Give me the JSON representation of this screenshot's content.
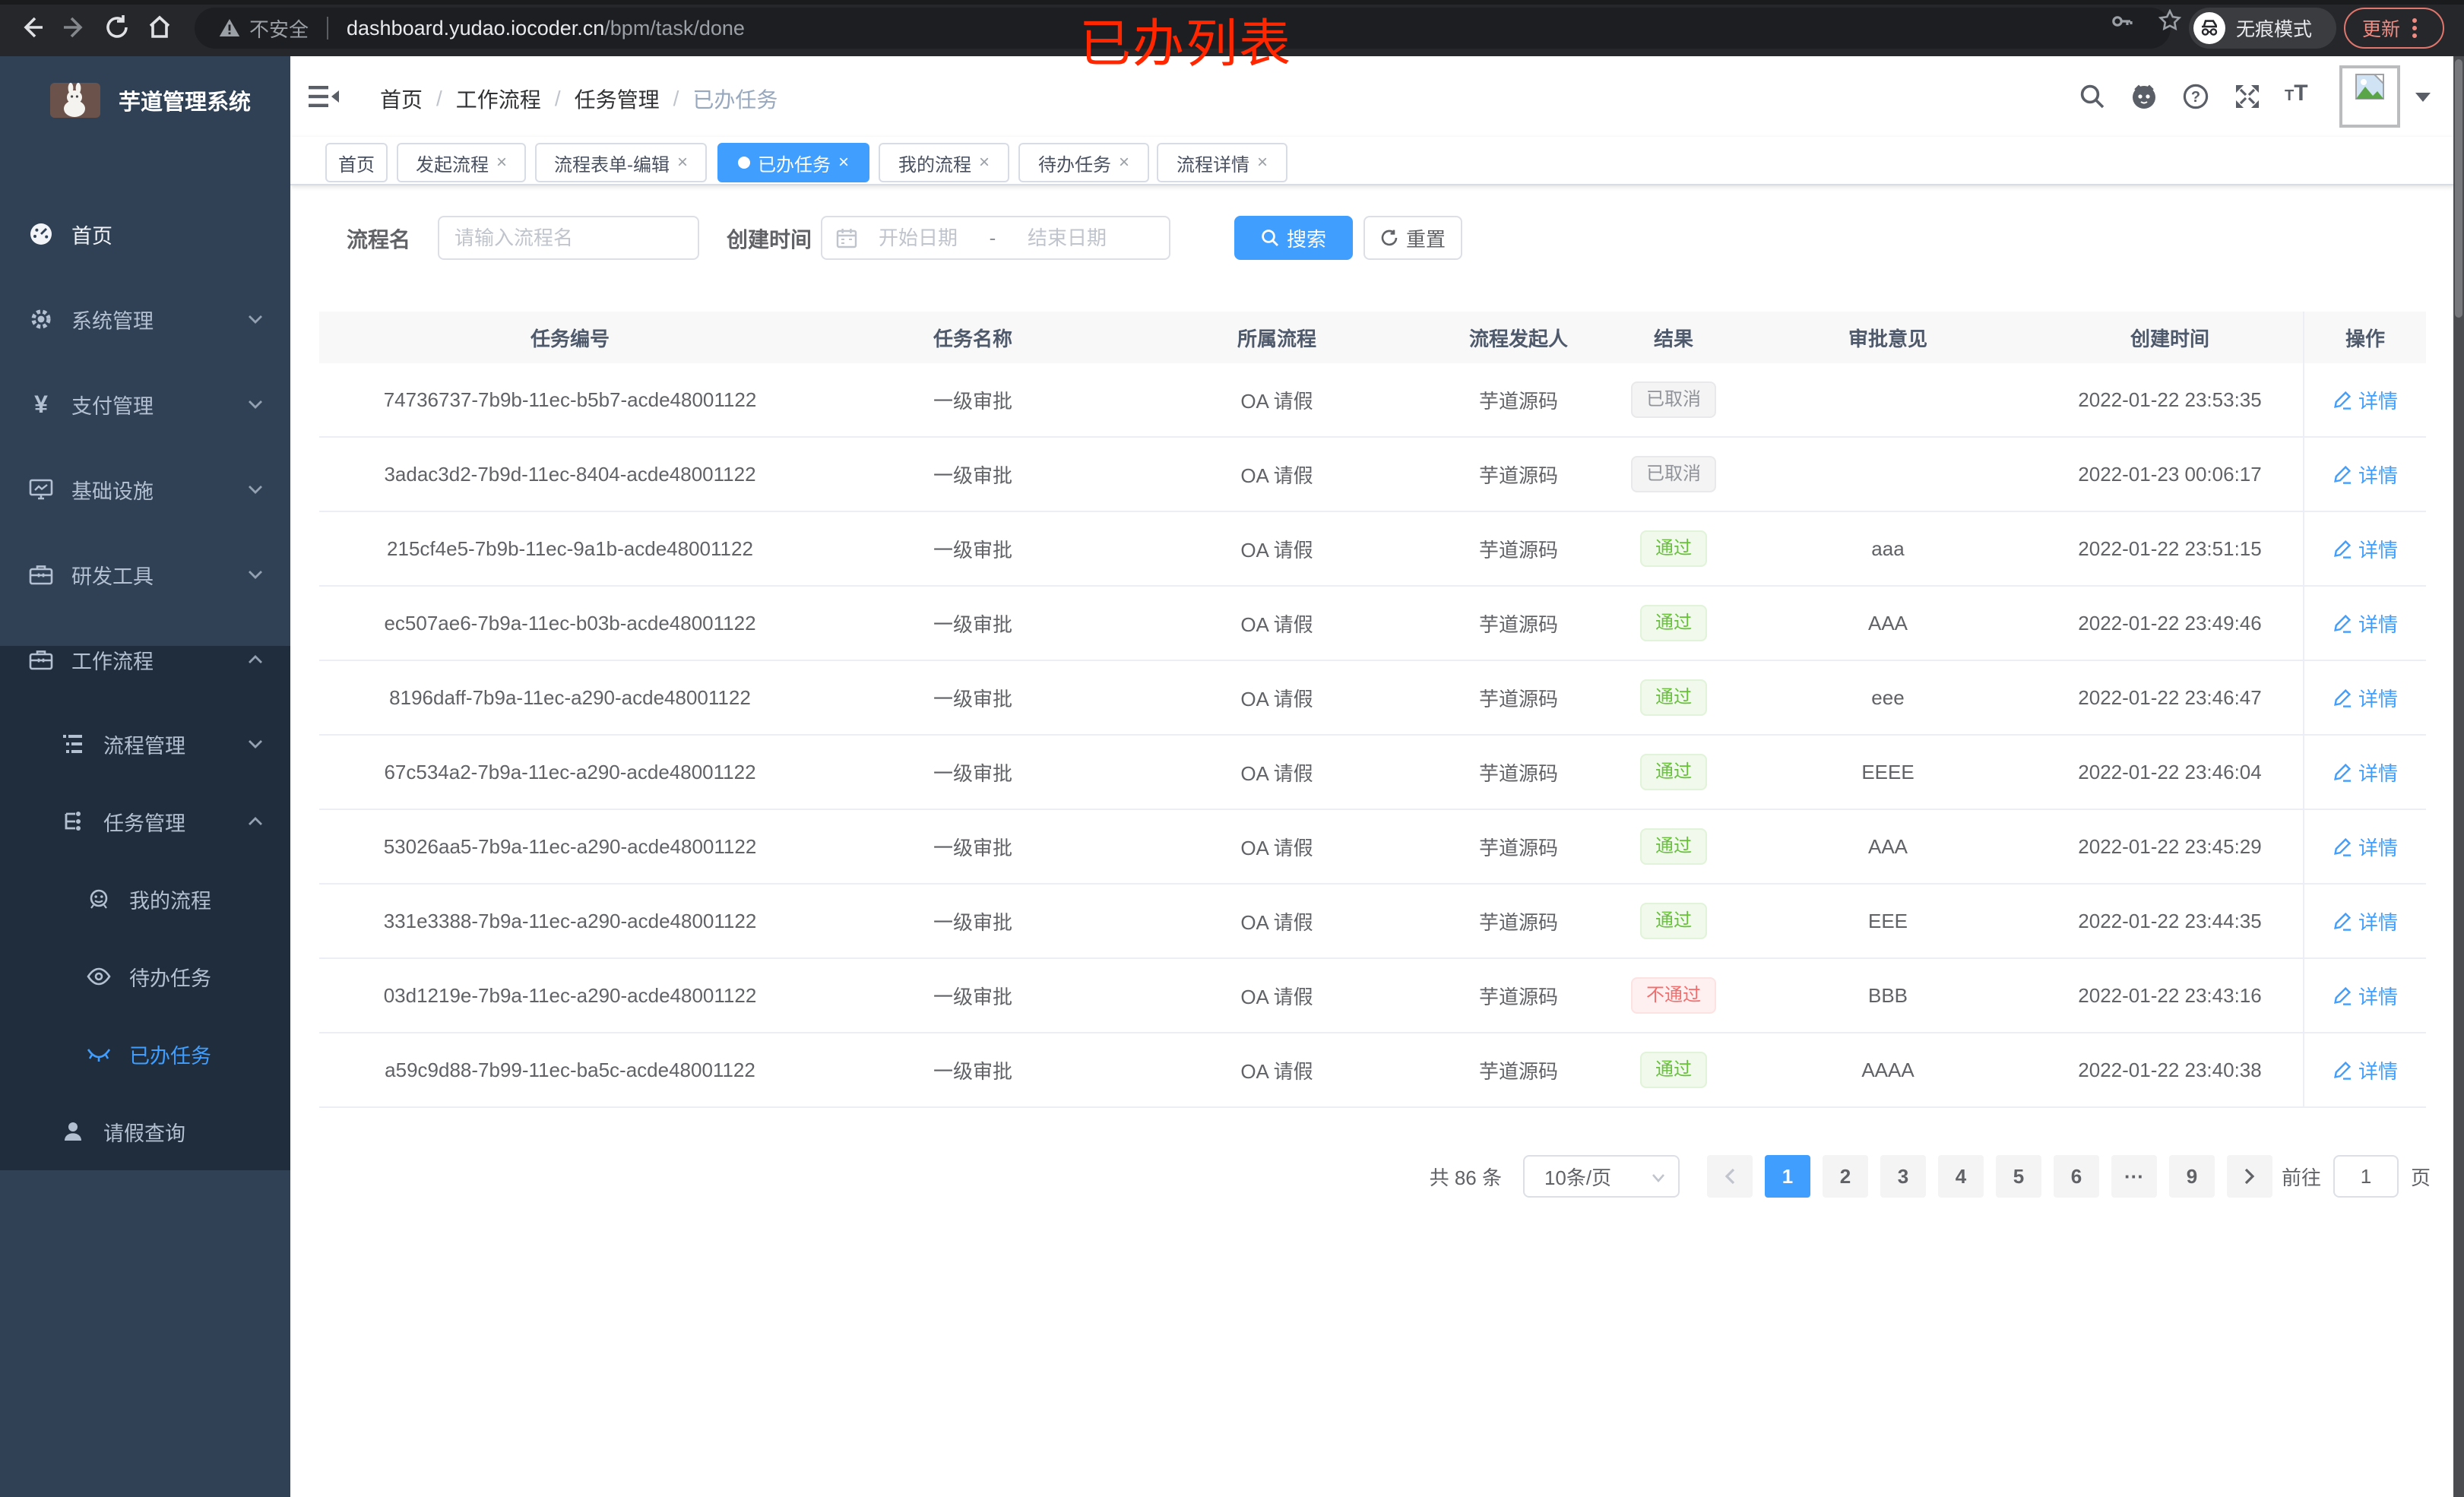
{
  "theme": {
    "accent": "#409eff",
    "success": "#67c23a",
    "danger": "#f56c6c",
    "info": "#909399",
    "sidebar_bg": "#304156",
    "submenu_bg": "#1f2d3d",
    "annotation_red": "#ff2600"
  },
  "browser": {
    "security_label": "不安全",
    "url_host": "dashboard.yudao.iocoder.cn",
    "url_path": "/bpm/task/done",
    "incognito_label": "无痕模式",
    "update_label": "更新",
    "annotation": "已办列表"
  },
  "sidebar": {
    "app_title": "芋道管理系统",
    "items": [
      {
        "label": "首页"
      },
      {
        "label": "系统管理"
      },
      {
        "label": "支付管理"
      },
      {
        "label": "基础设施"
      },
      {
        "label": "研发工具"
      },
      {
        "label": "工作流程"
      },
      {
        "label": "流程管理"
      },
      {
        "label": "任务管理"
      },
      {
        "label": "我的流程"
      },
      {
        "label": "待办任务"
      },
      {
        "label": "已办任务"
      },
      {
        "label": "请假查询"
      }
    ]
  },
  "header": {
    "breadcrumb": [
      "首页",
      "工作流程",
      "任务管理",
      "已办任务"
    ],
    "separator": "/"
  },
  "tabs": [
    {
      "label": "首页",
      "closable": false,
      "active": false
    },
    {
      "label": "发起流程",
      "closable": true,
      "active": false
    },
    {
      "label": "流程表单-编辑",
      "closable": true,
      "active": false
    },
    {
      "label": "已办任务",
      "closable": true,
      "active": true
    },
    {
      "label": "我的流程",
      "closable": true,
      "active": false
    },
    {
      "label": "待办任务",
      "closable": true,
      "active": false
    },
    {
      "label": "流程详情",
      "closable": true,
      "active": false
    }
  ],
  "filters": {
    "name_label": "流程名",
    "name_placeholder": "请输入流程名",
    "date_label": "创建时间",
    "date_start_placeholder": "开始日期",
    "date_separator": "-",
    "date_end_placeholder": "结束日期",
    "search_label": "搜索",
    "reset_label": "重置"
  },
  "table": {
    "columns": [
      "任务编号",
      "任务名称",
      "所属流程",
      "流程发起人",
      "结果",
      "审批意见",
      "创建时间",
      "操作"
    ],
    "rows": [
      {
        "id": "74736737-7b9b-11ec-b5b7-acde48001122",
        "name": "一级审批",
        "process": "OA 请假",
        "starter": "芋道源码",
        "result": "已取消",
        "result_type": "cancel",
        "opinion": "",
        "created": "2022-01-22 23:53:35",
        "action": "详情"
      },
      {
        "id": "3adac3d2-7b9d-11ec-8404-acde48001122",
        "name": "一级审批",
        "process": "OA 请假",
        "starter": "芋道源码",
        "result": "已取消",
        "result_type": "cancel",
        "opinion": "",
        "created": "2022-01-23 00:06:17",
        "action": "详情"
      },
      {
        "id": "215cf4e5-7b9b-11ec-9a1b-acde48001122",
        "name": "一级审批",
        "process": "OA 请假",
        "starter": "芋道源码",
        "result": "通过",
        "result_type": "pass",
        "opinion": "aaa",
        "created": "2022-01-22 23:51:15",
        "action": "详情"
      },
      {
        "id": "ec507ae6-7b9a-11ec-b03b-acde48001122",
        "name": "一级审批",
        "process": "OA 请假",
        "starter": "芋道源码",
        "result": "通过",
        "result_type": "pass",
        "opinion": "AAA",
        "created": "2022-01-22 23:49:46",
        "action": "详情"
      },
      {
        "id": "8196daff-7b9a-11ec-a290-acde48001122",
        "name": "一级审批",
        "process": "OA 请假",
        "starter": "芋道源码",
        "result": "通过",
        "result_type": "pass",
        "opinion": "eee",
        "created": "2022-01-22 23:46:47",
        "action": "详情"
      },
      {
        "id": "67c534a2-7b9a-11ec-a290-acde48001122",
        "name": "一级审批",
        "process": "OA 请假",
        "starter": "芋道源码",
        "result": "通过",
        "result_type": "pass",
        "opinion": "EEEE",
        "created": "2022-01-22 23:46:04",
        "action": "详情"
      },
      {
        "id": "53026aa5-7b9a-11ec-a290-acde48001122",
        "name": "一级审批",
        "process": "OA 请假",
        "starter": "芋道源码",
        "result": "通过",
        "result_type": "pass",
        "opinion": "AAA",
        "created": "2022-01-22 23:45:29",
        "action": "详情"
      },
      {
        "id": "331e3388-7b9a-11ec-a290-acde48001122",
        "name": "一级审批",
        "process": "OA 请假",
        "starter": "芋道源码",
        "result": "通过",
        "result_type": "pass",
        "opinion": "EEE",
        "created": "2022-01-22 23:44:35",
        "action": "详情"
      },
      {
        "id": "03d1219e-7b9a-11ec-a290-acde48001122",
        "name": "一级审批",
        "process": "OA 请假",
        "starter": "芋道源码",
        "result": "不通过",
        "result_type": "fail",
        "opinion": "BBB",
        "created": "2022-01-22 23:43:16",
        "action": "详情"
      },
      {
        "id": "a59c9d88-7b99-11ec-ba5c-acde48001122",
        "name": "一级审批",
        "process": "OA 请假",
        "starter": "芋道源码",
        "result": "通过",
        "result_type": "pass",
        "opinion": "AAAA",
        "created": "2022-01-22 23:40:38",
        "action": "详情"
      }
    ]
  },
  "pagination": {
    "total_label": "共 86 条",
    "page_size": "10条/页",
    "pages": [
      "1",
      "2",
      "3",
      "4",
      "5",
      "6",
      "···",
      "9"
    ],
    "active_page": "1",
    "goto_label": "前往",
    "goto_value": "1",
    "goto_unit": "页"
  },
  "icons": {
    "browser": [
      "back-icon",
      "forward-icon",
      "reload-icon",
      "home-icon",
      "warning-icon",
      "key-icon",
      "star-icon",
      "incognito-icon",
      "kebab-menu-icon"
    ],
    "header": [
      "search-icon",
      "github-icon",
      "help-icon",
      "fullscreen-icon",
      "font-size-icon",
      "avatar-placeholder"
    ],
    "sidebar": [
      "dashboard-icon",
      "gear-icon",
      "yen-icon",
      "monitor-icon",
      "toolbox-icon",
      "briefcase-icon",
      "list-icon",
      "flow-icon",
      "robot-icon",
      "eye-icon",
      "eye-closed-icon",
      "person-icon"
    ]
  }
}
